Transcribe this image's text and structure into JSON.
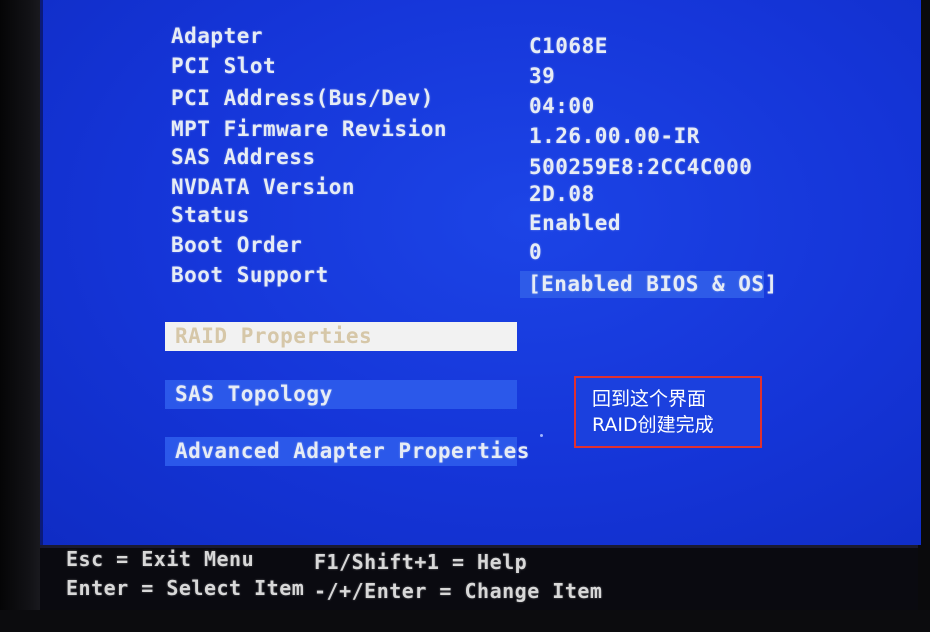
{
  "adapter_info": {
    "rows": [
      {
        "label": "Adapter",
        "value": "C1068E"
      },
      {
        "label": "PCI Slot",
        "value": "39"
      },
      {
        "label": "PCI Address(Bus/Dev)",
        "value": "04:00"
      },
      {
        "label": "MPT Firmware Revision",
        "value": "1.26.00.00-IR"
      },
      {
        "label": "SAS Address",
        "value": "500259E8:2CC4C000"
      },
      {
        "label": "NVDATA Version",
        "value": "2D.08"
      },
      {
        "label": "Status",
        "value": "Enabled"
      },
      {
        "label": "Boot Order",
        "value": "0"
      },
      {
        "label": "Boot Support",
        "value": "[Enabled BIOS & OS]"
      }
    ]
  },
  "menu": {
    "items": [
      {
        "label": "RAID Properties",
        "selected": true
      },
      {
        "label": "SAS Topology",
        "selected": false
      },
      {
        "label": "Advanced Adapter Properties",
        "selected": false
      }
    ]
  },
  "annotation": {
    "line1": "回到这个界面",
    "line2": "RAID创建完成",
    "border_color": "#e03030"
  },
  "footer": {
    "esc": "Esc = Exit Menu",
    "enter": "Enter = Select Item",
    "help": "F1/Shift+1 = Help",
    "change": "-/+/Enter = Change Item"
  },
  "colors": {
    "screen_blue": "#1535d8",
    "highlight_blue": "#2b58ea",
    "selected_bg": "#f2f2f2",
    "text": "#e6ecf5"
  }
}
